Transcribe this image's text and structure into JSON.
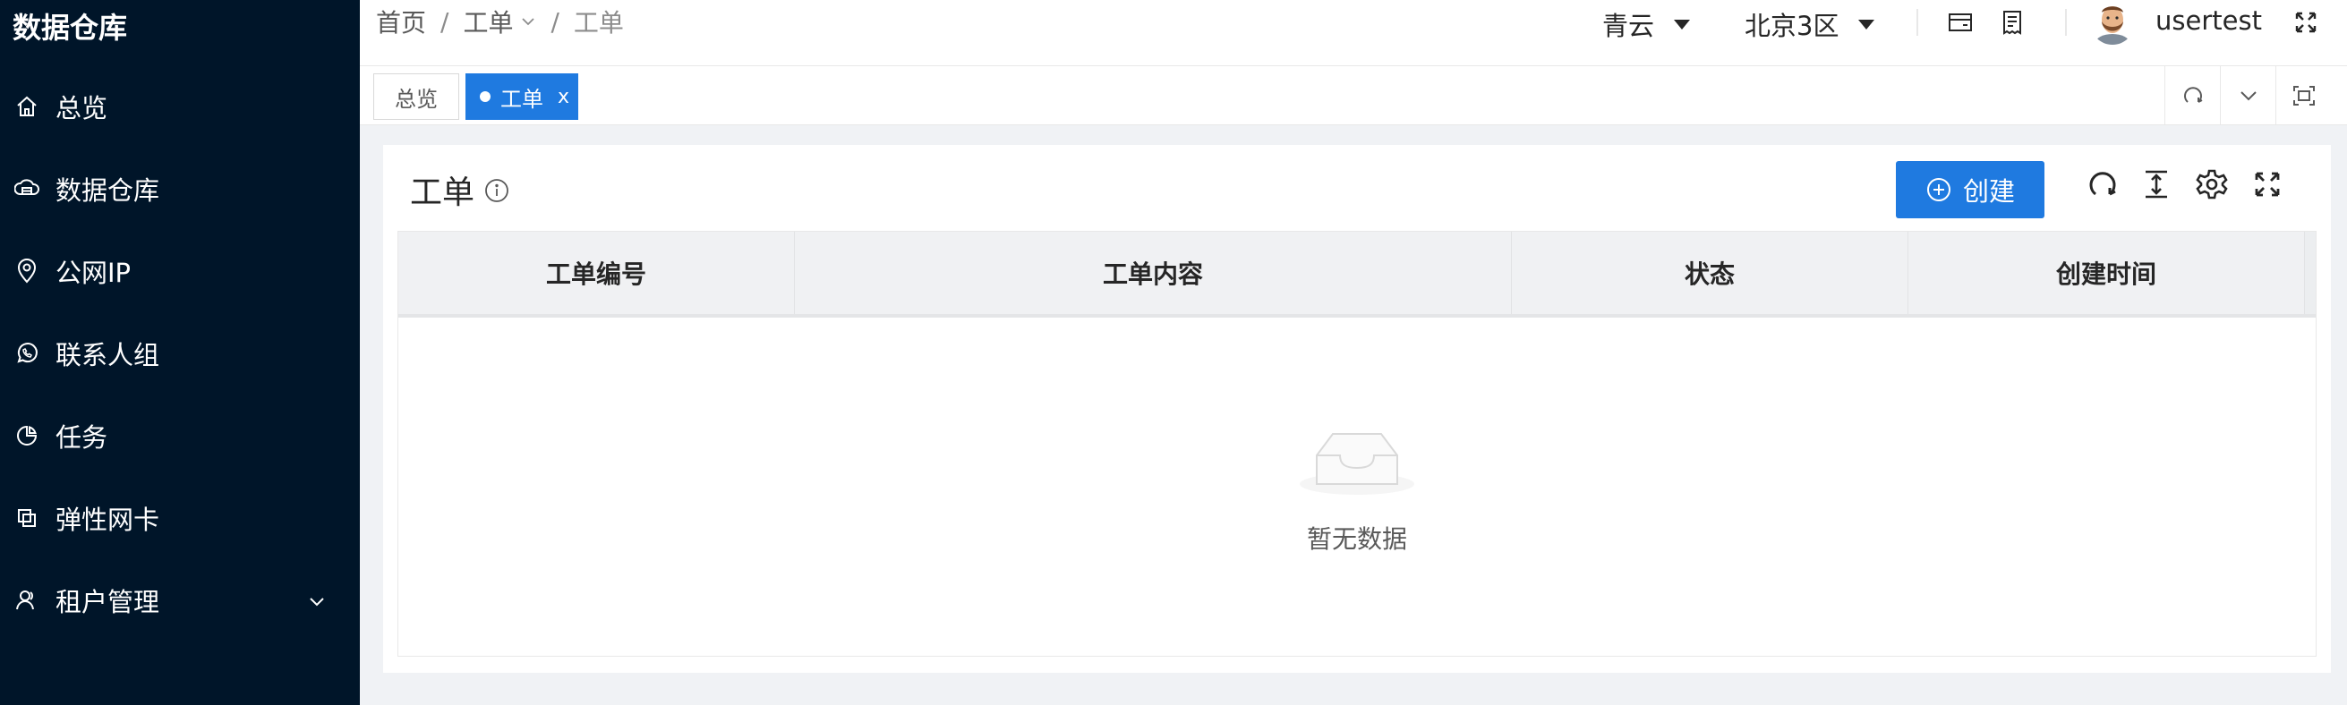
{
  "sidebar": {
    "brand": "数据仓库",
    "items": [
      {
        "label": "总览",
        "icon": "home-icon"
      },
      {
        "label": "数据仓库",
        "icon": "cloud-storage-icon"
      },
      {
        "label": "公网IP",
        "icon": "location-pin-icon"
      },
      {
        "label": "联系人组",
        "icon": "phone-chat-icon"
      },
      {
        "label": "任务",
        "icon": "pie-chart-icon"
      },
      {
        "label": "弹性网卡",
        "icon": "copy-network-card-icon"
      },
      {
        "label": "租户管理",
        "icon": "user-icon",
        "expandable": true
      }
    ]
  },
  "header": {
    "breadcrumb": [
      "首页",
      "工单",
      "工单"
    ],
    "breadcrumb_sep": "/",
    "provider": "青云",
    "region": "北京3区",
    "username": "usertest"
  },
  "tabs": {
    "items": [
      {
        "label": "总览",
        "active": false
      },
      {
        "label": "工单",
        "active": true,
        "close": "x"
      }
    ]
  },
  "main": {
    "title": "工单",
    "create_label": "创建",
    "table": {
      "columns": [
        "工单编号",
        "工单内容",
        "状态",
        "创建时间"
      ],
      "rows": [],
      "empty_text": "暂无数据"
    }
  },
  "colors": {
    "sidebar_bg": "#001529",
    "primary": "#1f7ae0",
    "table_header_bg": "#f0f1f3",
    "page_bg": "#f0f2f5"
  }
}
